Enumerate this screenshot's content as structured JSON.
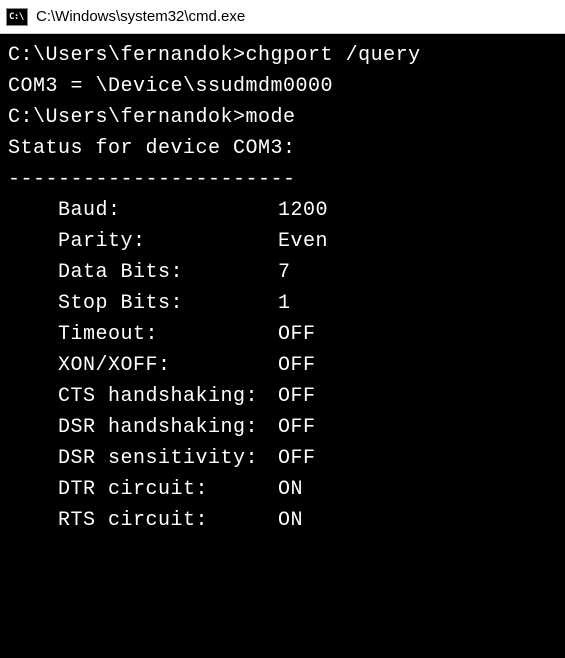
{
  "window": {
    "icon_label": "C:\\",
    "title": "C:\\Windows\\system32\\cmd.exe"
  },
  "terminal": {
    "line1_prompt": "C:\\Users\\fernandok>",
    "line1_cmd": "chgport /query",
    "line2": "COM3 = \\Device\\ssudmdm0000",
    "blank1": "",
    "line3_prompt": "C:\\Users\\fernandok>",
    "line3_cmd": "mode",
    "blank2": "",
    "status_header": "Status for device COM3:",
    "status_dashes": "-----------------------",
    "rows": [
      {
        "label": "Baud:",
        "value": "1200"
      },
      {
        "label": "Parity:",
        "value": "Even"
      },
      {
        "label": "Data Bits:",
        "value": "7"
      },
      {
        "label": "Stop Bits:",
        "value": "1"
      },
      {
        "label": "Timeout:",
        "value": "OFF"
      },
      {
        "label": "XON/XOFF:",
        "value": "OFF"
      },
      {
        "label": "CTS handshaking:",
        "value": "OFF"
      },
      {
        "label": "DSR handshaking:",
        "value": "OFF"
      },
      {
        "label": "DSR sensitivity:",
        "value": "OFF"
      },
      {
        "label": "DTR circuit:",
        "value": "ON"
      },
      {
        "label": "RTS circuit:",
        "value": "ON"
      }
    ]
  }
}
